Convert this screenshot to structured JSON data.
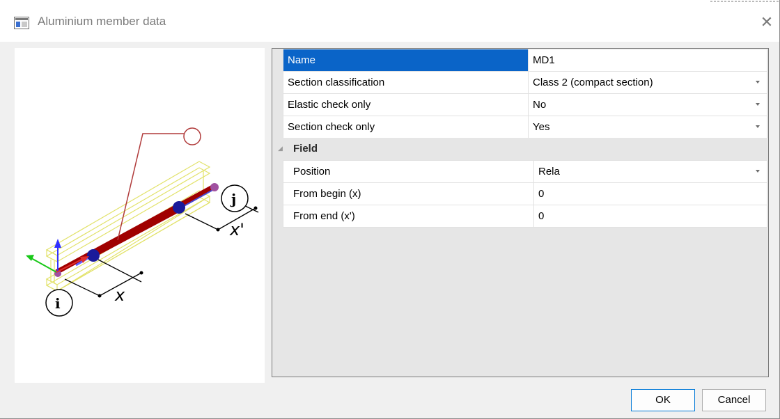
{
  "window": {
    "title": "Aluminium member data",
    "close_glyph": "✕"
  },
  "preview": {
    "label_i": "i",
    "label_j": "j",
    "label_x": "x",
    "label_x_prime": "x'"
  },
  "properties": {
    "rows": [
      {
        "name": "Name",
        "value": "MD1",
        "dropdown": false,
        "selected": true
      },
      {
        "name": "Section classification",
        "value": "Class 2 (compact section)",
        "dropdown": true
      },
      {
        "name": "Elastic check only",
        "value": "No",
        "dropdown": true
      },
      {
        "name": "Section check only",
        "value": "Yes",
        "dropdown": true
      }
    ],
    "group": {
      "label": "Field",
      "expand_glyph": "◢"
    },
    "field_rows": [
      {
        "name": "Position",
        "value": "Rela",
        "dropdown": true
      },
      {
        "name": "From begin (x)",
        "value": "0",
        "dropdown": false
      },
      {
        "name": "From end (x')",
        "value": "0",
        "dropdown": false
      }
    ]
  },
  "buttons": {
    "ok": "OK",
    "cancel": "Cancel"
  },
  "colors": {
    "selection": "#0a64c8",
    "member": "#a00000",
    "profile_outline": "#e2e26a",
    "node": "#1a1a9a",
    "leader": "#b03a3a"
  }
}
